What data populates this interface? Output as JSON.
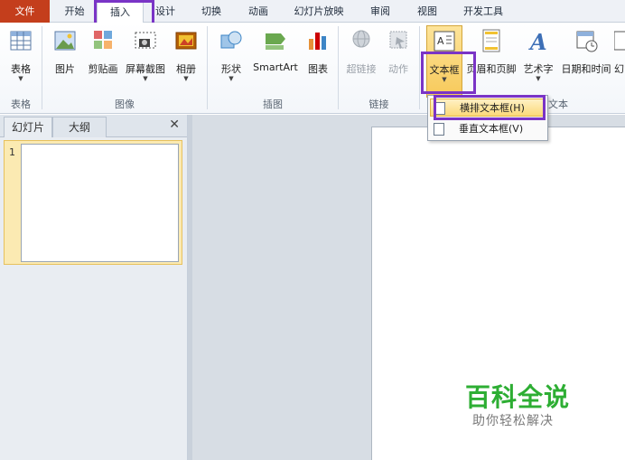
{
  "tabs": [
    {
      "label": "文件"
    },
    {
      "label": "开始"
    },
    {
      "label": "插入"
    },
    {
      "label": "设计"
    },
    {
      "label": "切换"
    },
    {
      "label": "动画"
    },
    {
      "label": "幻灯片放映"
    },
    {
      "label": "审阅"
    },
    {
      "label": "视图"
    },
    {
      "label": "开发工具"
    }
  ],
  "ribbon": {
    "buttons": [
      {
        "label": "表格",
        "icon": "table-icon",
        "has_dropdown": true
      },
      {
        "label": "图片",
        "icon": "picture-icon",
        "has_dropdown": false
      },
      {
        "label": "剪贴画",
        "icon": "clipart-icon",
        "has_dropdown": false
      },
      {
        "label": "屏幕截图",
        "icon": "screenshot-icon",
        "has_dropdown": true
      },
      {
        "label": "相册",
        "icon": "photo-album-icon",
        "has_dropdown": true
      },
      {
        "label": "形状",
        "icon": "shapes-icon",
        "has_dropdown": true
      },
      {
        "label": "SmartArt",
        "icon": "smartart-icon",
        "has_dropdown": false
      },
      {
        "label": "图表",
        "icon": "chart-icon",
        "has_dropdown": false
      },
      {
        "label": "超链接",
        "icon": "hyperlink-icon",
        "disabled": true
      },
      {
        "label": "动作",
        "icon": "action-icon",
        "disabled": true
      },
      {
        "label": "文本框",
        "icon": "textbox-icon",
        "has_dropdown": true,
        "pressed": true
      },
      {
        "label": "页眉和页脚",
        "icon": "header-footer-icon",
        "has_dropdown": false
      },
      {
        "label": "艺术字",
        "icon": "wordart-icon",
        "has_dropdown": true
      },
      {
        "label": "日期和时间",
        "icon": "date-time-icon",
        "has_dropdown": false
      },
      {
        "label": "幻",
        "icon": "slide-number-icon",
        "has_dropdown": false
      }
    ],
    "groups": [
      {
        "label": "表格"
      },
      {
        "label": "图像"
      },
      {
        "label": "插图"
      },
      {
        "label": "链接"
      },
      {
        "label": "文本"
      }
    ]
  },
  "dropdown": {
    "items": [
      {
        "label": "横排文本框(H)",
        "icon": "horizontal-textbox-icon",
        "highlighted": true
      },
      {
        "label": "垂直文本框(V)",
        "icon": "vertical-textbox-icon",
        "highlighted": false
      }
    ]
  },
  "pane": {
    "tabs": [
      {
        "label": "幻灯片"
      },
      {
        "label": "大纲"
      }
    ],
    "close_glyph": "✕",
    "slides": [
      {
        "number": "1"
      }
    ]
  },
  "watermark": {
    "title": "百科全说",
    "subtitle": "助你轻松解决"
  },
  "colors": {
    "file_tab": "#c43e1c",
    "highlight_box": "#7a34c6",
    "pressed_button": "#f7c95a",
    "watermark_green": "#2dae33"
  }
}
